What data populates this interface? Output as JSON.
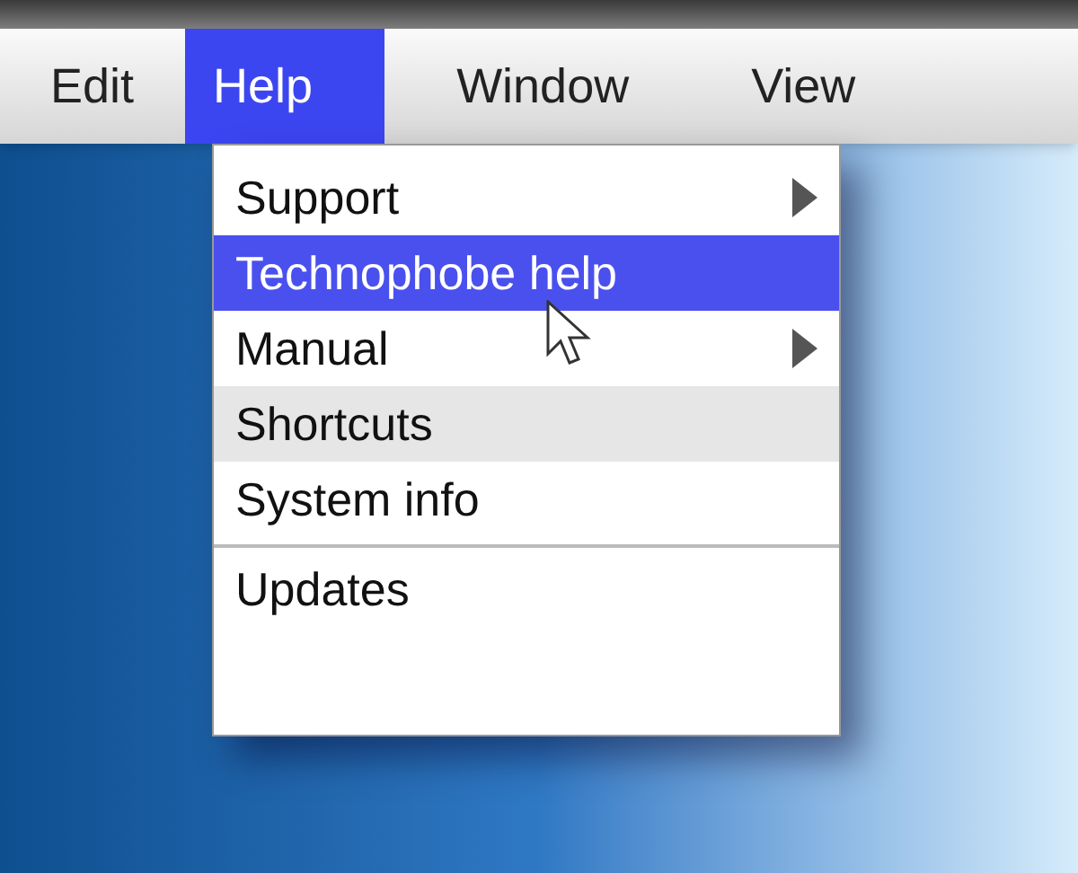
{
  "menu_bar": [
    {
      "label": "Edit",
      "selected": false
    },
    {
      "label": "Help",
      "selected": true
    },
    {
      "label": "Window",
      "selected": false
    },
    {
      "label": "View",
      "selected": false
    }
  ],
  "dropdown": [
    {
      "label": "Support",
      "selected": false,
      "shaded": false,
      "submenu": true,
      "separator_above": false
    },
    {
      "label": "Technophobe help",
      "selected": true,
      "shaded": false,
      "submenu": false,
      "separator_above": false
    },
    {
      "label": "Manual",
      "selected": false,
      "shaded": false,
      "submenu": true,
      "separator_above": false
    },
    {
      "label": "Shortcuts",
      "selected": false,
      "shaded": true,
      "submenu": false,
      "separator_above": false
    },
    {
      "label": "System info",
      "selected": false,
      "shaded": false,
      "submenu": false,
      "separator_above": false
    },
    {
      "label": "Updates",
      "selected": false,
      "shaded": false,
      "submenu": false,
      "separator_above": true
    }
  ]
}
